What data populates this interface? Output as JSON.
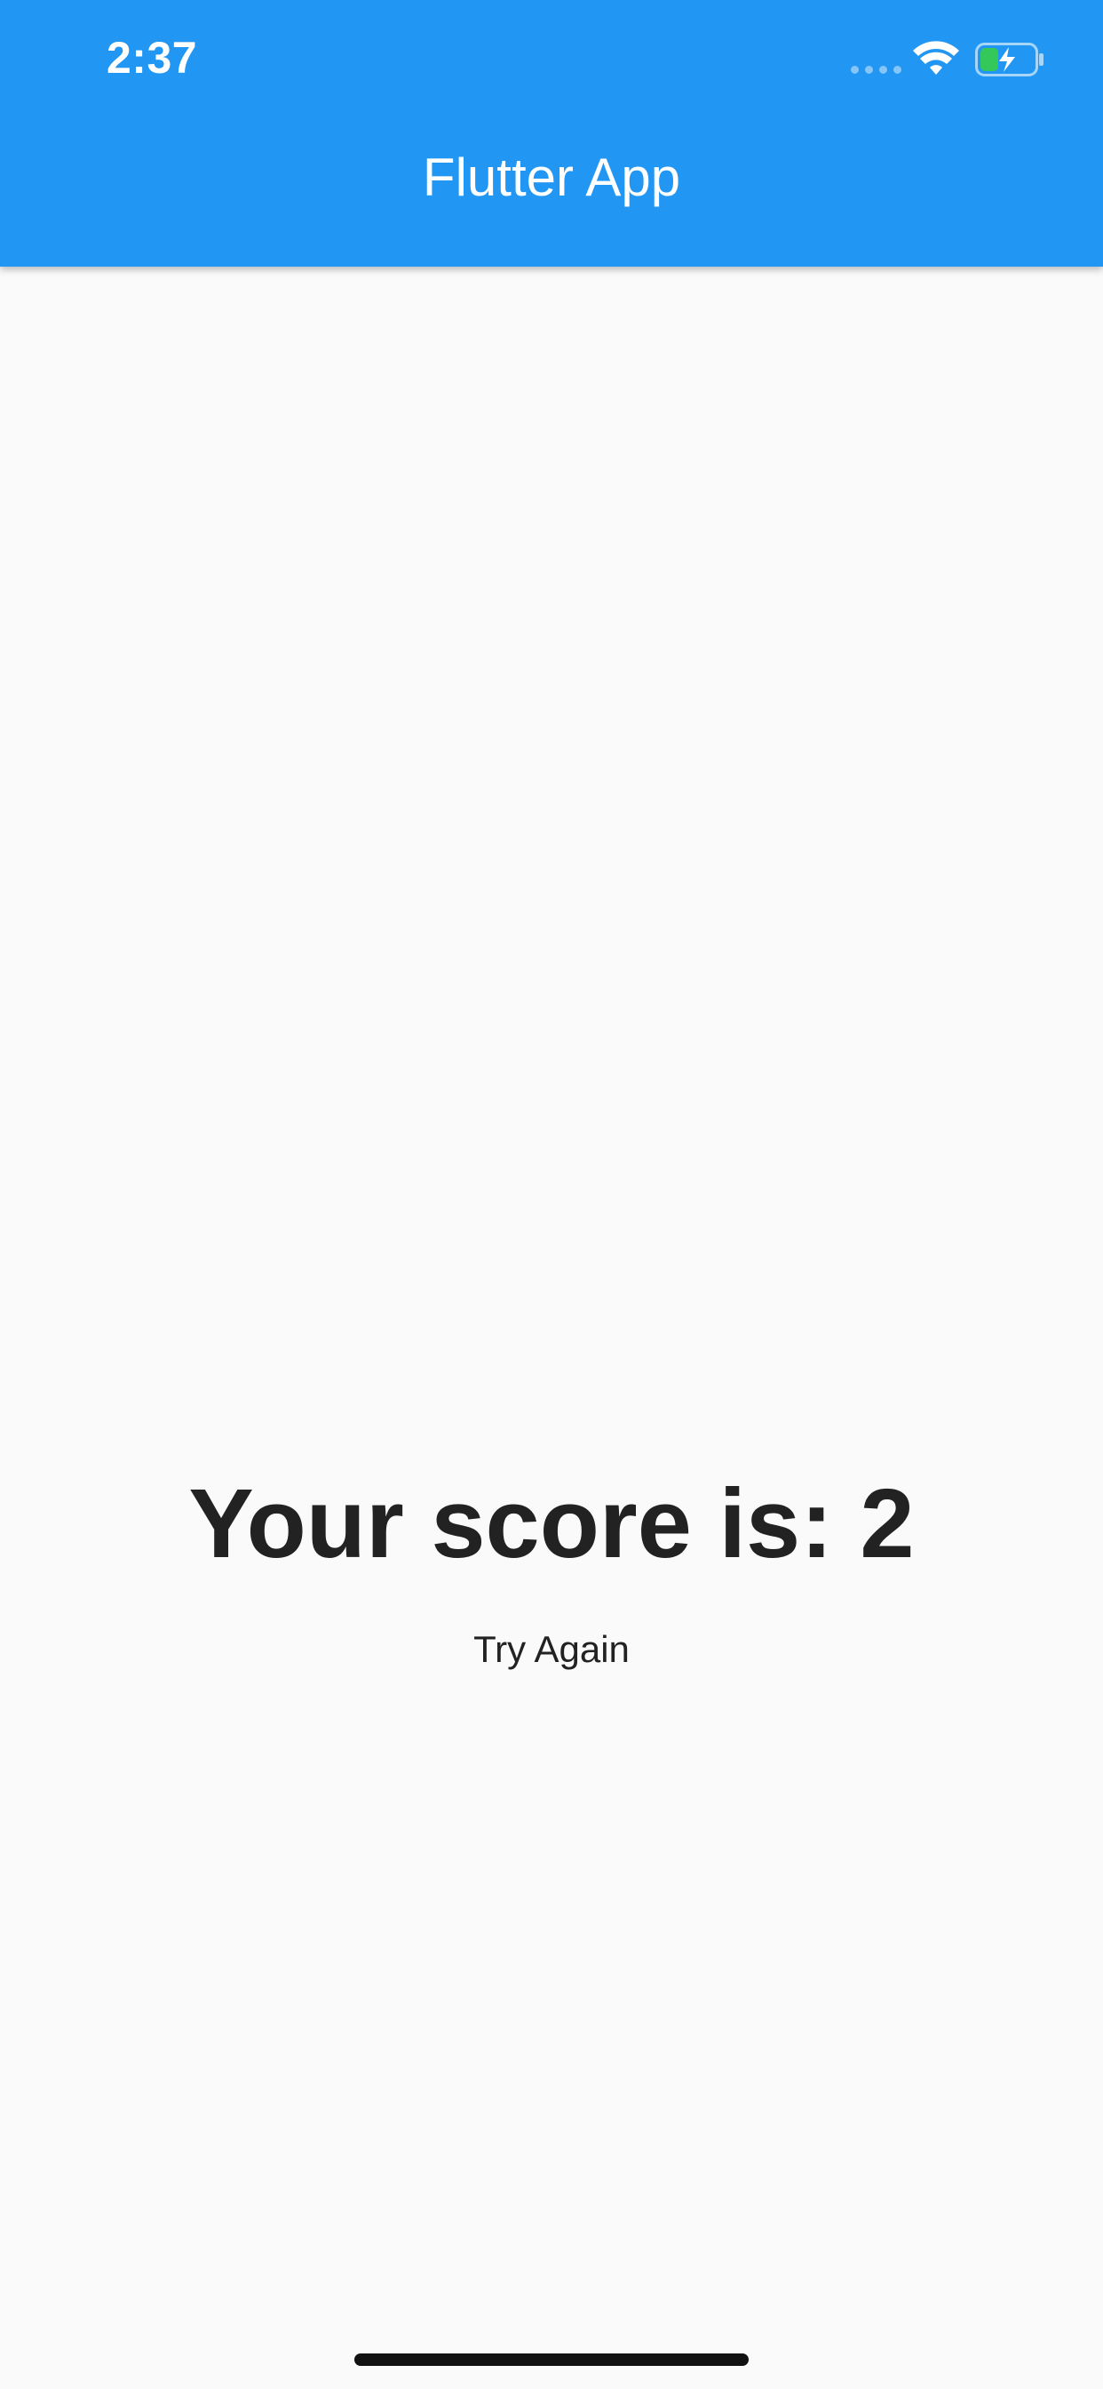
{
  "status_bar": {
    "time": "2:37",
    "icons": [
      "signal-dots-icon",
      "wifi-icon",
      "battery-charging-icon"
    ],
    "battery_fill_color": "#34c759"
  },
  "app_bar": {
    "title": "Flutter App",
    "background_color": "#2196f3"
  },
  "result": {
    "score_text": "Your score is: 2",
    "try_again_label": "Try Again"
  },
  "colors": {
    "page_background": "#fafafa",
    "text": "#222222"
  }
}
